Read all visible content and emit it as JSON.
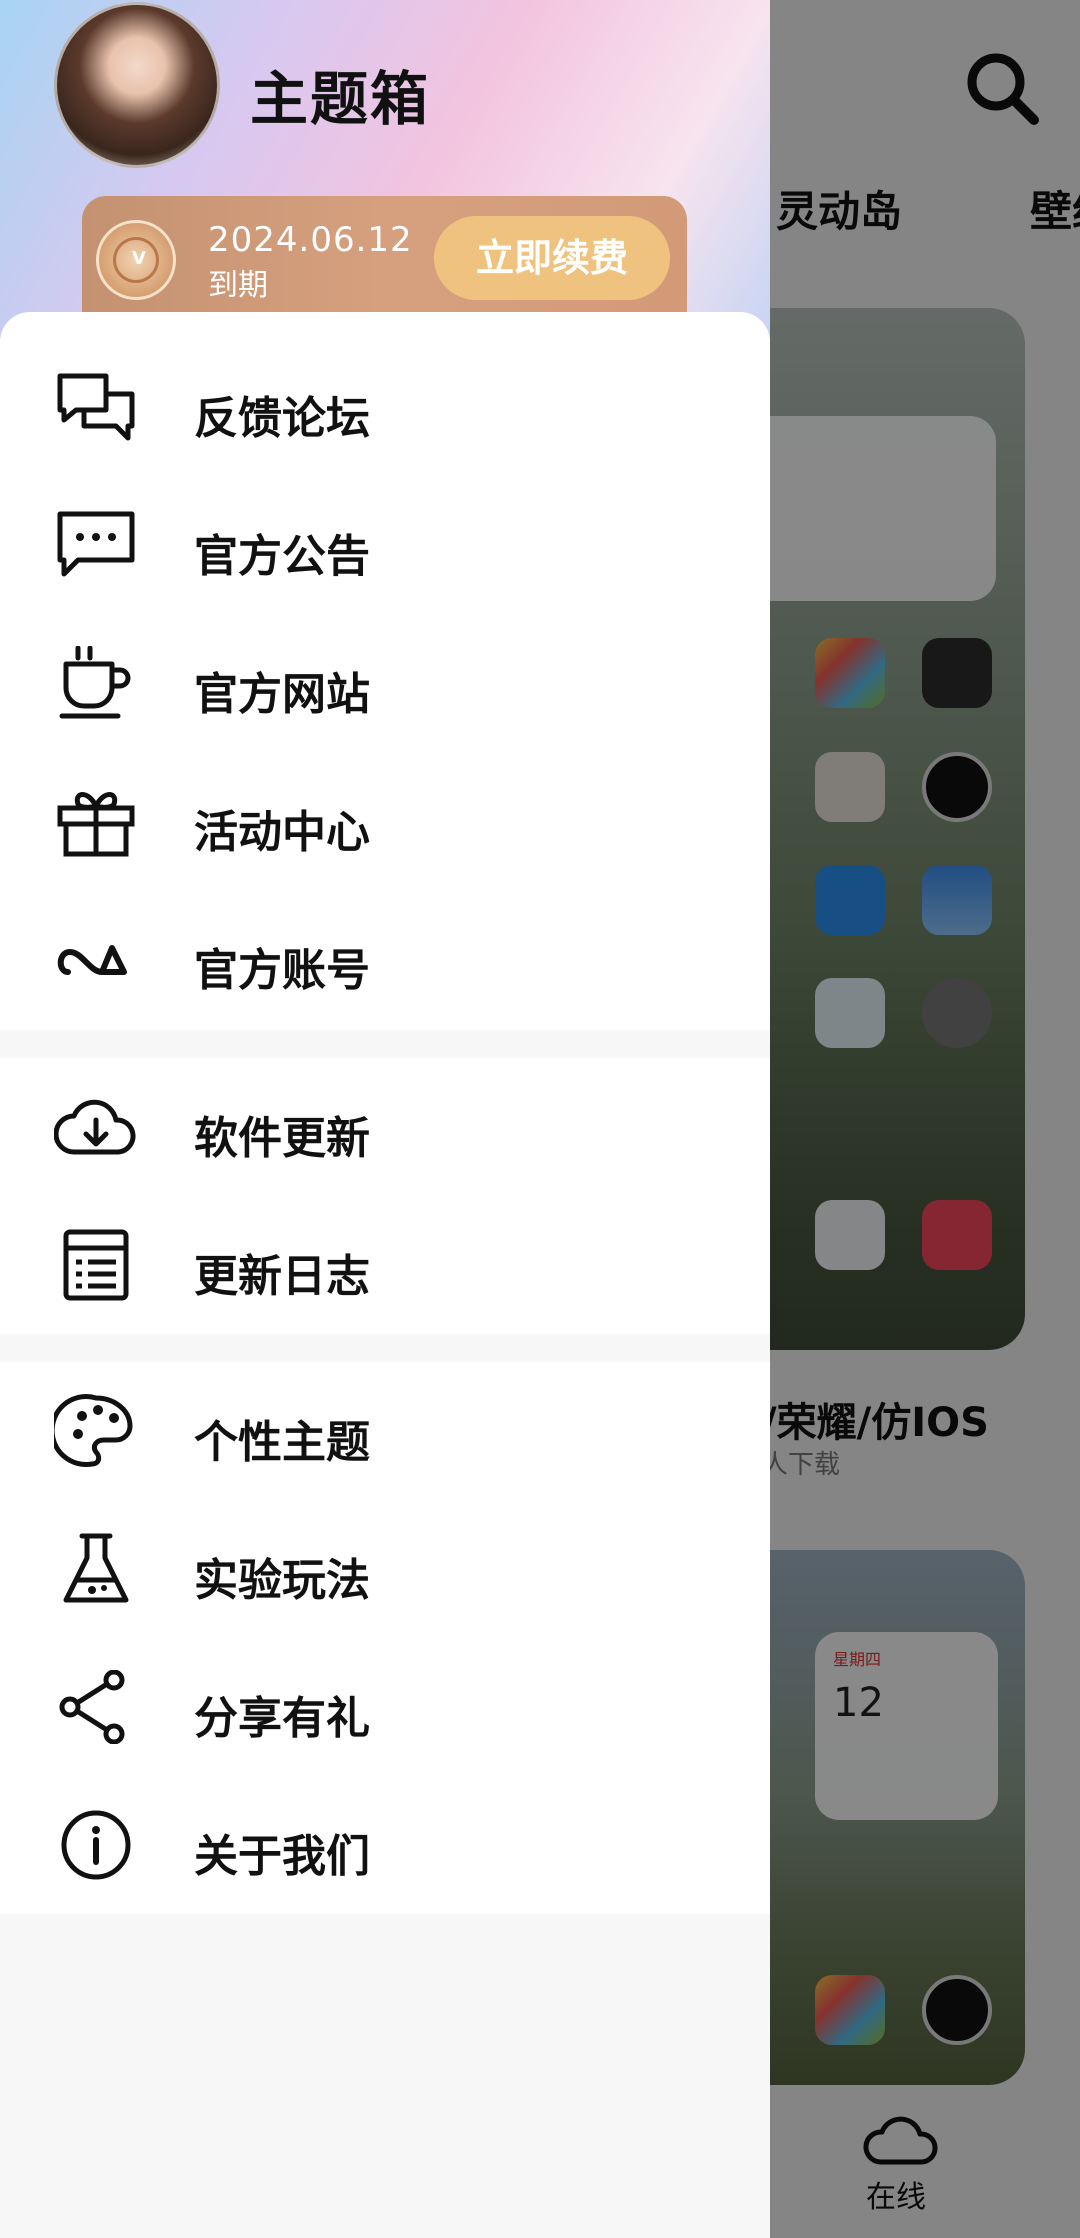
{
  "app": {
    "title": "主题箱"
  },
  "vip": {
    "expire_date": "2024.06.12",
    "expire_label": "到期",
    "renew_label": "立即续费"
  },
  "menu": {
    "group1": [
      {
        "label": "反馈论坛",
        "icon": "chat-bubbles-icon"
      },
      {
        "label": "官方公告",
        "icon": "message-dots-icon"
      },
      {
        "label": "官方网站",
        "icon": "coffee-cup-icon"
      },
      {
        "label": "活动中心",
        "icon": "gift-icon"
      },
      {
        "label": "官方账号",
        "icon": "brand-logo-icon"
      }
    ],
    "group2": [
      {
        "label": "软件更新",
        "icon": "cloud-download-icon"
      },
      {
        "label": "更新日志",
        "icon": "list-doc-icon"
      }
    ],
    "group3": [
      {
        "label": "个性主题",
        "icon": "palette-icon"
      },
      {
        "label": "实验玩法",
        "icon": "flask-icon"
      },
      {
        "label": "分享有礼",
        "icon": "share-icon"
      },
      {
        "label": "关于我们",
        "icon": "info-icon"
      }
    ]
  },
  "background": {
    "tabs": [
      "灵动岛",
      "壁纸"
    ],
    "card_title": "/荣耀/仿IOS",
    "card_subtitle": "人下载",
    "widget_weekday": "星期四",
    "widget_date": "12",
    "nav_label": "在线"
  },
  "colors": {
    "renew_button": "#f0c27f",
    "vip_card": "#d6a07e",
    "dim_overlay": "rgba(0,0,0,0.45)"
  }
}
